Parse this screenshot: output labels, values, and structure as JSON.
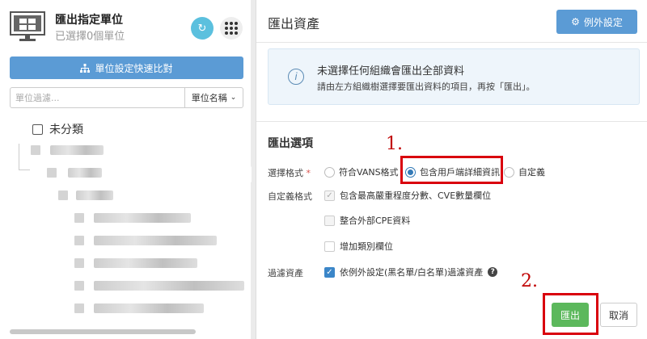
{
  "left_panel": {
    "title": "匯出指定單位",
    "subtitle": "已選擇0個單位",
    "refresh_icon": "refresh-icon",
    "grid_icon": "grid-menu-icon",
    "quick_button_label": "單位設定快速比對",
    "filter_placeholder": "單位過濾...",
    "filter_select_value": "單位名稱",
    "uncategorized_label": "未分類"
  },
  "right_panel": {
    "title": "匯出資產",
    "exception_button_label": "例外設定",
    "info_line1": "未選擇任何組織會匯出全部資料",
    "info_line2": "請由左方組織樹選擇要匯出資料的項目，再按「匯出」。",
    "options_title": "匯出選項",
    "format_label": "選擇格式",
    "required_mark": "*",
    "format_options": [
      "符合VANS格式",
      "包含用戶端詳細資訊",
      "自定義"
    ],
    "selected_format": "包含用戶端詳細資訊",
    "custom_format_label": "自定義格式",
    "custom_options": [
      "包含最高嚴重程度分數、CVE數量欄位",
      "整合外部CPE資料",
      "增加類別欄位"
    ],
    "filter_assets_label": "過濾資產",
    "filter_assets_option": "依例外設定(黑名單/白名單)過濾資產",
    "export_button_label": "匯出",
    "cancel_button_label": "取消"
  },
  "annotations": {
    "step1": "1.",
    "step2": "2.",
    "highlight_color": "#d9000d"
  },
  "colors": {
    "primary_blue": "#5b9bd5",
    "export_green": "#5cb85c",
    "info_bg": "#eef5fb"
  }
}
